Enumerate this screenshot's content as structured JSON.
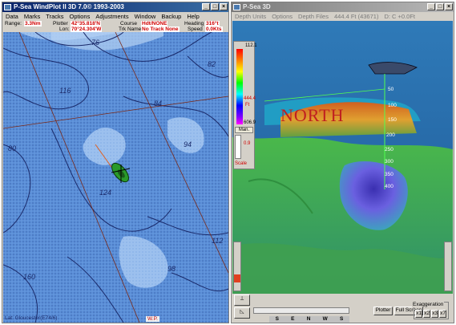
{
  "left_window": {
    "title": "P-Sea WindPlot II 3D 7.0© 1993-2003",
    "menu": [
      "Data",
      "Marks",
      "Tracks",
      "Options",
      "Adjustments",
      "Window",
      "Backup",
      "Help"
    ],
    "info": {
      "range_label": "Range:",
      "range_value": "3.3Nm",
      "plotter_label": "Plotter",
      "lat_value": "42°35.818'N",
      "lon_label": "Lon:",
      "lon_value": "70°24.304'W",
      "course_label": "Course",
      "course_value": "Hdt/NONE",
      "track_label": "Trk Name",
      "track_value": "No Track None",
      "heading_label": "Heading",
      "heading_value": "316°t",
      "speed_label": "Speed",
      "speed_value": "0.0Kts"
    },
    "map_labels": [
      "76",
      "84",
      "82",
      "116",
      "80",
      "124",
      "94",
      "112",
      "160",
      "98"
    ],
    "footer_left": "Lat: Gloucester(E74/6)",
    "footer_mid": "W.P."
  },
  "right_window": {
    "title": "P-Sea 3D",
    "menu": [
      "Depth Units",
      "Options",
      "Depth Files",
      "444.4 Ft (43671)",
      "D: C +0.0Ft"
    ],
    "legend": {
      "top_value": "112.1",
      "mid_value": "444.4",
      "mid_unit": "Ft",
      "bottom_value": "606.9",
      "man_label": "Man.",
      "scale_label": "Scale",
      "small_value": "0.9"
    },
    "scene_label": "NORTH",
    "depth_ticks": [
      "50",
      "100",
      "150",
      "200",
      "250",
      "300",
      "350",
      "400"
    ],
    "buttons": {
      "plotter": "Plotter",
      "full_screen": "Full Screen",
      "exaggeration_label": "Exaggeration",
      "x1": "x1",
      "x2": "x2",
      "x3": "x3",
      "x7": "x7"
    },
    "compass": [
      "S",
      "E",
      "N",
      "W",
      "S"
    ]
  },
  "colors": {
    "titlebar_active": "#0a246a",
    "water": "#5b8fd8",
    "contour": "#1a2a6a",
    "value_red": "#d00000",
    "terrain_green": "#3fae3f",
    "deep_blue": "#4a3fcf"
  }
}
